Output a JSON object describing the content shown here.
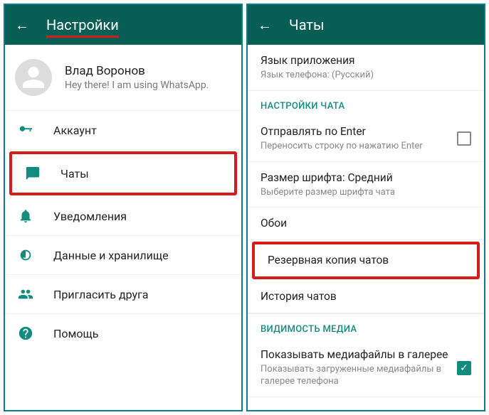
{
  "left": {
    "header": {
      "title": "Настройки"
    },
    "profile": {
      "name": "Влад Воронов",
      "status": "Hey there! I am using WhatsApp."
    },
    "items": {
      "account": "Аккаунт",
      "chats": "Чаты",
      "notifications": "Уведомления",
      "data": "Данные и хранилище",
      "invite": "Пригласить друга",
      "help": "Помощь"
    }
  },
  "right": {
    "header": {
      "title": "Чаты"
    },
    "lang": {
      "title": "Язык приложения",
      "sub": "Язык телефона: (Русский)"
    },
    "section_chat": "НАСТРОЙКИ ЧАТА",
    "enter": {
      "title": "Отправлять по Enter",
      "sub": "Переносить строку по нажатию Enter"
    },
    "font": {
      "title": "Размер шрифта: Средний",
      "sub": "Выберите размер шрифта чата"
    },
    "wallpaper": {
      "title": "Обои"
    },
    "backup": {
      "title": "Резервная копия чатов"
    },
    "history": {
      "title": "История чатов"
    },
    "section_media": "ВИДИМОСТЬ МЕДИА",
    "media": {
      "title": "Показывать медиафайлы в галерее",
      "sub": "Показывать загруженные медиафайлы в галерее телефона"
    }
  }
}
